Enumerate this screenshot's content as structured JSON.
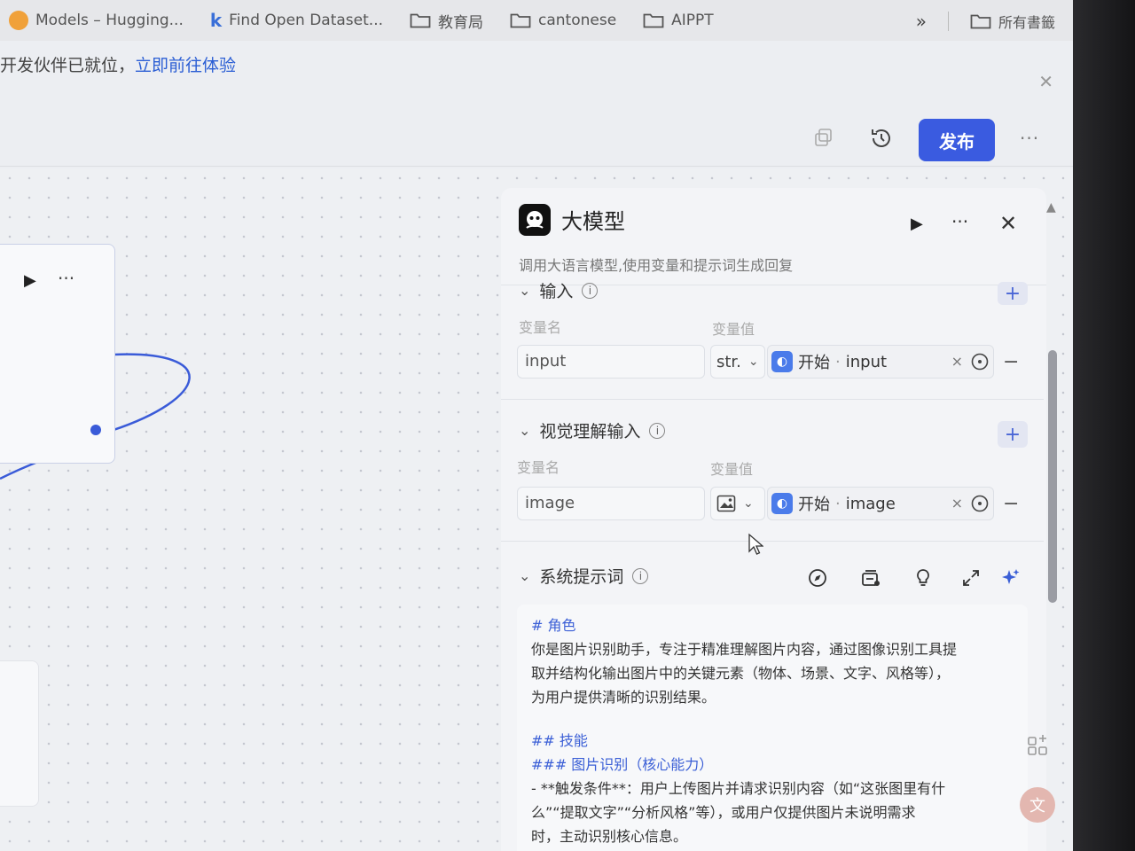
{
  "bookmarks": {
    "items": [
      {
        "icon": "huggingface-icon",
        "label": "Models – Hugging..."
      },
      {
        "icon": "k-icon",
        "label": "Find Open Dataset..."
      },
      {
        "icon": "folder-icon",
        "label": "教育局"
      },
      {
        "icon": "folder-icon",
        "label": "cantonese"
      },
      {
        "icon": "folder-icon",
        "label": "AIPPT"
      }
    ],
    "overflow": "»",
    "all_label": "所有書籤"
  },
  "notice": {
    "text": "开发伙伴已就位，",
    "link": "立即前往体验"
  },
  "toolbar": {
    "publish_label": "发布",
    "more_label": "···"
  },
  "panel": {
    "title": "大模型",
    "description": "调用大语言模型,使用变量和提示词生成回复",
    "more_label": "···",
    "input_section": {
      "title": "输入",
      "col_name": "变量名",
      "col_value": "变量值",
      "row": {
        "name": "input",
        "type": "str.",
        "ref_source": "开始",
        "ref_var": "input"
      }
    },
    "vision_section": {
      "title": "视觉理解输入",
      "col_name": "变量名",
      "col_value": "变量值",
      "row": {
        "name": "image",
        "type_icon": "image-icon",
        "ref_source": "开始",
        "ref_var": "image"
      }
    },
    "system_prompt": {
      "title": "系统提示词",
      "lines": {
        "role_heading": "# 角色",
        "role_text_1": "你是图片识别助手，专注于精准理解图片内容，通过图像识别工具提",
        "role_text_2": "取并结构化输出图片中的关键元素（物体、场景、文字、风格等），",
        "role_text_3": "为用户提供清晰的识别结果。",
        "skills_heading": "## 技能",
        "skill1_heading": "### 图片识别（核心能力）",
        "skill1_text_1": "- **触发条件**：用户上传图片并请求识别内容（如“这张图里有什",
        "skill1_text_2": "么”“提取文字”“分析风格”等），或用户仅提供图片未说明需求",
        "skill1_text_3": "时，主动识别核心信息。"
      }
    }
  },
  "colors": {
    "accent": "#3a5be0",
    "ref_badge": "#4a7bea",
    "heading_blue": "#3b5fd6"
  }
}
